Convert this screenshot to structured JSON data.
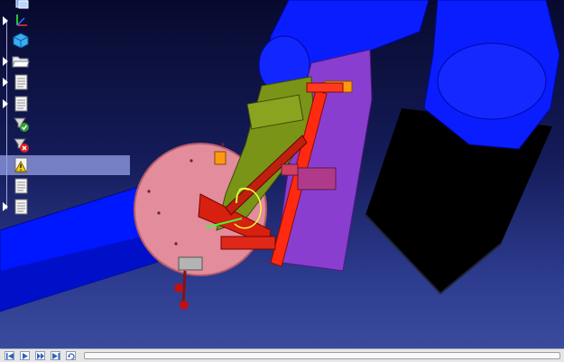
{
  "scene": {
    "background_top": "#070a2e",
    "background_bottom": "#3a4a9c",
    "robot_color": "#0019ff",
    "pedestal_color": "#000000",
    "turntable_color": "#e08a9a",
    "bracket_color": "#ff2a10",
    "torch_color": "#6f8a10"
  },
  "tree": {
    "items": [
      {
        "icon": "cube-stack-icon",
        "expander": false
      },
      {
        "icon": "axis-frame-icon",
        "expander": true
      },
      {
        "icon": "cube-icon",
        "expander": false
      },
      {
        "icon": "folder-open-icon",
        "expander": true
      },
      {
        "icon": "document-icon",
        "expander": true
      },
      {
        "icon": "document-icon",
        "expander": true
      },
      {
        "icon": "check-status-icon",
        "expander": false
      },
      {
        "icon": "error-status-icon",
        "expander": false
      },
      {
        "icon": "warning-document-icon",
        "expander": false,
        "selected": true
      },
      {
        "icon": "document-icon",
        "expander": false
      },
      {
        "icon": "document-icon",
        "expander": true
      }
    ]
  },
  "playback": {
    "controls": [
      "skip-back-icon",
      "play-icon",
      "fast-forward-icon",
      "skip-end-icon",
      "loop-icon"
    ],
    "position": 0.0
  }
}
